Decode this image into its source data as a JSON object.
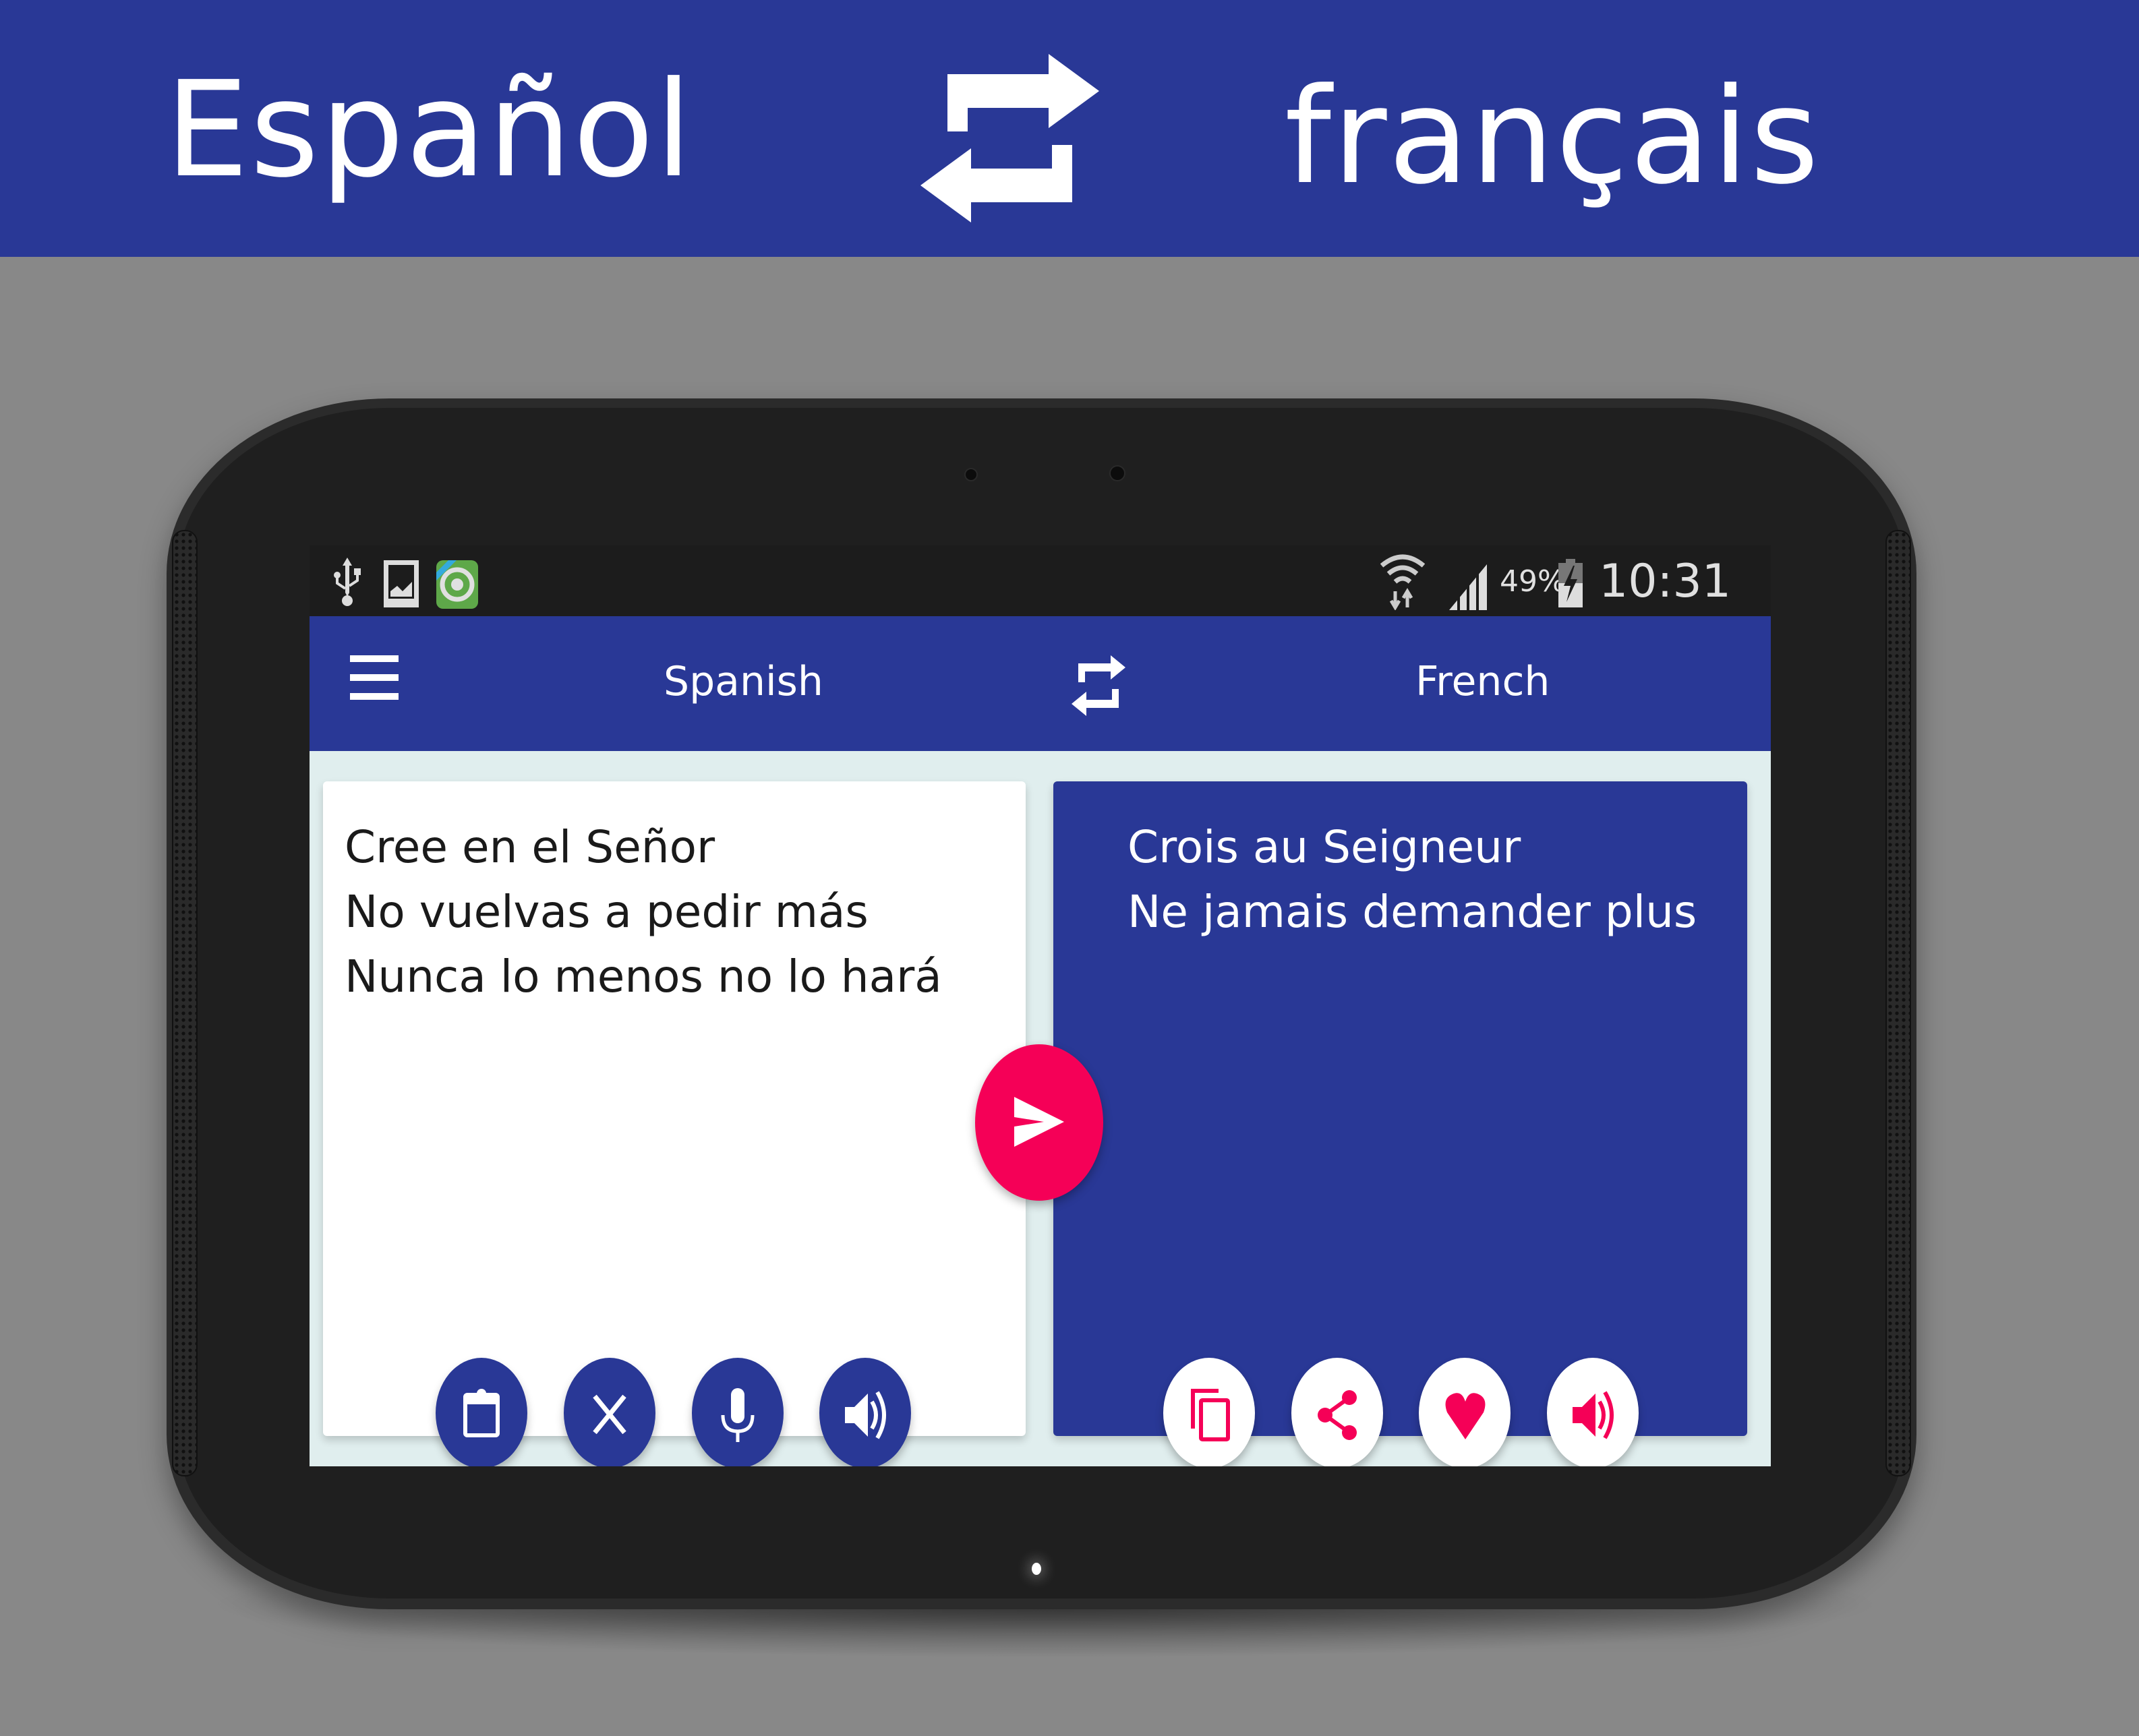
{
  "banner": {
    "source_language": "Español",
    "target_language": "français",
    "swap_icon": "swap-arrows-icon"
  },
  "status_bar": {
    "left_icons": [
      "usb-icon",
      "gallery-icon",
      "app-notification-icon"
    ],
    "right_icons": [
      "wifi-icon",
      "signal-icon",
      "battery-charging-icon"
    ],
    "battery_percent": "49%",
    "time": "10:31 AM"
  },
  "app_bar": {
    "menu_icon": "hamburger-menu-icon",
    "source_language": "Spanish",
    "swap_icon": "swap-arrows-icon",
    "target_language": "French"
  },
  "input_card": {
    "text": "Cree en el Señor\nNo vuelvas a pedir más\nNunca lo menos no lo hará",
    "actions": [
      {
        "name": "paste",
        "icon": "clipboard-icon"
      },
      {
        "name": "clear",
        "icon": "close-icon"
      },
      {
        "name": "voice-input",
        "icon": "microphone-icon"
      },
      {
        "name": "speak",
        "icon": "speaker-icon"
      }
    ]
  },
  "translate_button": {
    "icon": "send-icon"
  },
  "output_card": {
    "text": "Crois au Seigneur\nNe jamais demander plus",
    "actions": [
      {
        "name": "copy",
        "icon": "copy-icon"
      },
      {
        "name": "share",
        "icon": "share-icon"
      },
      {
        "name": "favorite",
        "icon": "heart-icon"
      },
      {
        "name": "speak",
        "icon": "speaker-icon"
      }
    ]
  },
  "colors": {
    "primary": "#293896",
    "accent": "#f50057",
    "background": "#888888",
    "screen_background": "#e0eeee"
  }
}
